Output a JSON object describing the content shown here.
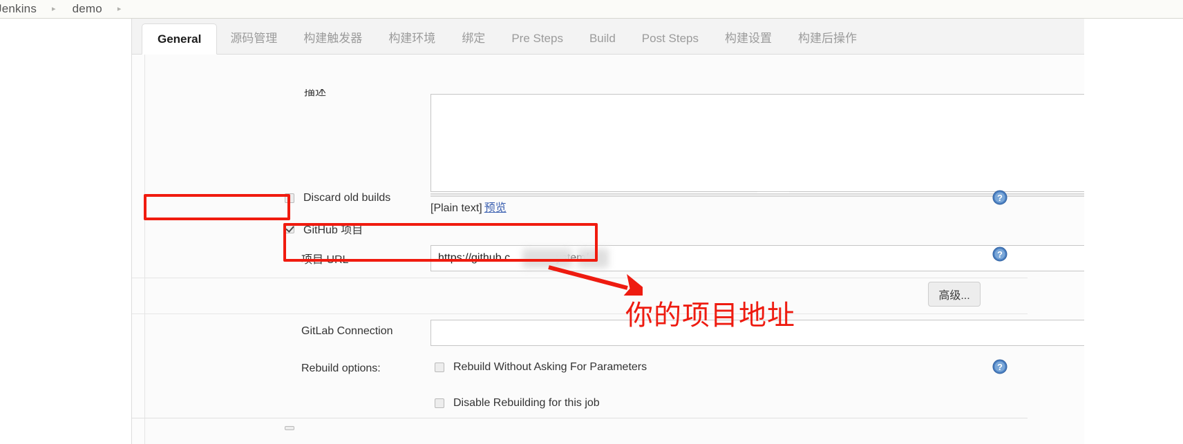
{
  "breadcrumb": {
    "items": [
      "Jenkins",
      "demo"
    ],
    "separator_icon": "chevron-right-icon"
  },
  "tabs": [
    {
      "label": "General",
      "active": true
    },
    {
      "label": "源码管理",
      "active": false
    },
    {
      "label": "构建触发器",
      "active": false
    },
    {
      "label": "构建环境",
      "active": false
    },
    {
      "label": "绑定",
      "active": false
    },
    {
      "label": "Pre Steps",
      "active": false
    },
    {
      "label": "Build",
      "active": false
    },
    {
      "label": "Post Steps",
      "active": false
    },
    {
      "label": "构建设置",
      "active": false
    },
    {
      "label": "构建后操作",
      "active": false
    }
  ],
  "form": {
    "description_label": "描述",
    "description_value": "",
    "plain_text_note": "[Plain text]",
    "preview_link": "预览",
    "discard_old_builds": {
      "label": "Discard old builds",
      "checked": false
    },
    "github_project": {
      "label": "GitHub 项目",
      "checked": true
    },
    "project_url": {
      "label": "项目 URL",
      "value": "https://github.c               ystem/"
    },
    "advanced_button": "高级...",
    "gitlab_connection": {
      "label": "GitLab Connection",
      "value": "",
      "caret_icon": "chevron-down-icon"
    },
    "rebuild_options": {
      "label": "Rebuild options:",
      "items": [
        {
          "label": "Rebuild Without Asking For Parameters",
          "checked": false
        },
        {
          "label": "Disable Rebuilding for this job",
          "checked": false
        }
      ]
    },
    "help_icon_name": "help-question-icon"
  },
  "annotations": {
    "text": "你的项目地址",
    "color": "#ee1b10",
    "arrow_icon": "red-arrow-icon",
    "boxes": [
      "github-project-checkbox",
      "project-url-input"
    ]
  }
}
